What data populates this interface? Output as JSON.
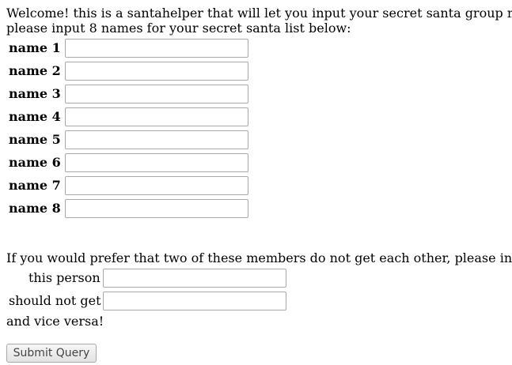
{
  "intro": {
    "line1": "Welcome! this is a santahelper that will let you input your secret santa group m",
    "line2": "please input 8 names for your secret santa list below:"
  },
  "names": [
    {
      "label": "name 1",
      "value": ""
    },
    {
      "label": "name 2",
      "value": ""
    },
    {
      "label": "name 3",
      "value": ""
    },
    {
      "label": "name 4",
      "value": ""
    },
    {
      "label": "name 5",
      "value": ""
    },
    {
      "label": "name 6",
      "value": ""
    },
    {
      "label": "name 7",
      "value": ""
    },
    {
      "label": "name 8",
      "value": ""
    }
  ],
  "exclusion": {
    "prompt": "If you would prefer that two of these members do not get each other, please inp",
    "person_label": "this person",
    "person_value": "",
    "not_get_label": "should not get",
    "not_get_value": "",
    "vice_versa": "and vice versa!"
  },
  "submit_label": "Submit Query"
}
